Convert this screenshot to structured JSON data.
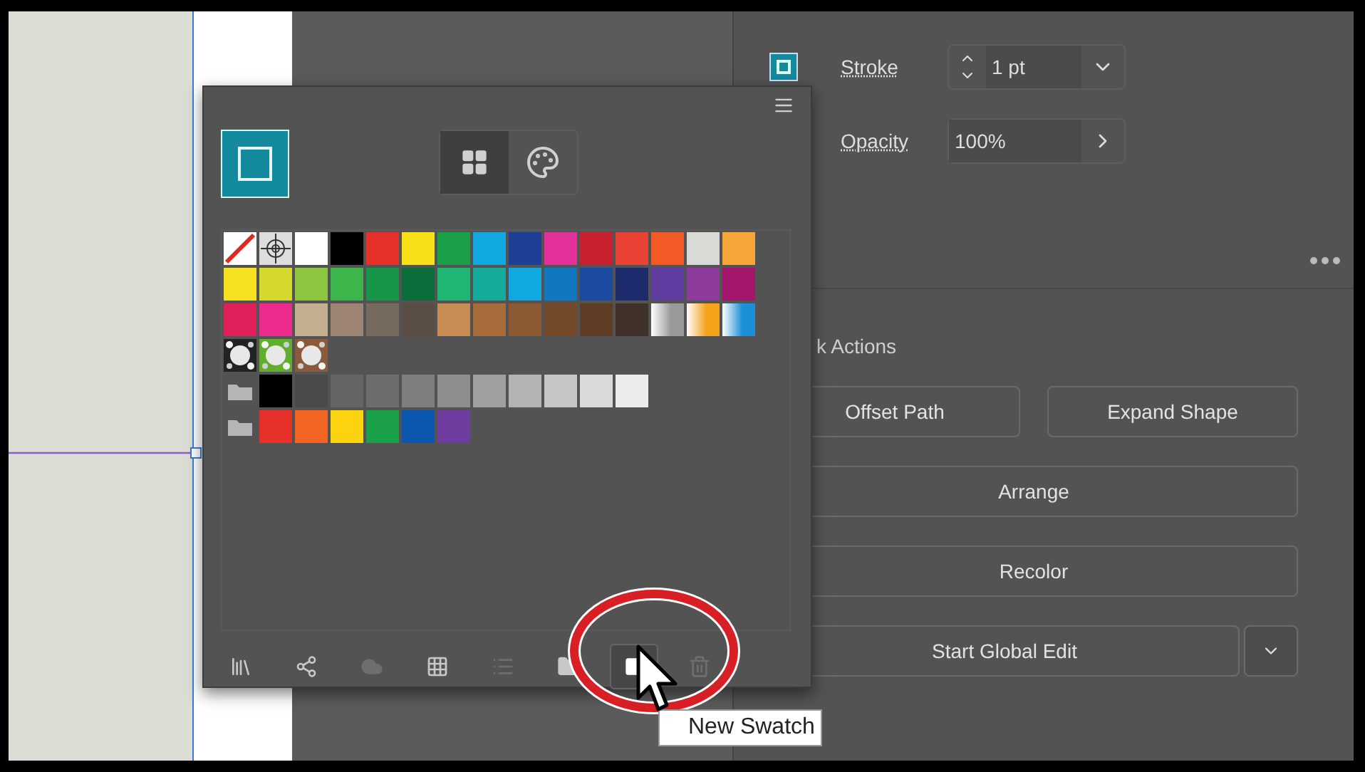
{
  "properties": {
    "stroke_label": "Stroke",
    "stroke_value": "1 pt",
    "opacity_label": "Opacity",
    "opacity_value": "100%"
  },
  "quick_actions": {
    "heading": "k Actions",
    "rows": [
      {
        "buttons": [
          "Offset Path",
          "Expand Shape"
        ],
        "has_menu": false
      },
      {
        "buttons": [
          "Arrange"
        ],
        "has_menu": false
      },
      {
        "buttons": [
          "Recolor"
        ],
        "has_menu": false
      },
      {
        "buttons": [
          "Start Global Edit"
        ],
        "has_menu": true
      }
    ]
  },
  "swatches_panel": {
    "view_tabs": [
      {
        "kind": "grid",
        "selected": true
      },
      {
        "kind": "palette",
        "selected": false
      }
    ],
    "rows": [
      {
        "folder": false,
        "swatches": [
          {
            "kind": "none",
            "color": "#ffffff"
          },
          {
            "kind": "registration",
            "color": "#dddddd"
          },
          {
            "kind": "solid",
            "color": "#ffffff"
          },
          {
            "kind": "solid",
            "color": "#000000"
          },
          {
            "kind": "solid",
            "color": "#e8302a"
          },
          {
            "kind": "solid",
            "color": "#f7e017"
          },
          {
            "kind": "solid",
            "color": "#1aa049"
          },
          {
            "kind": "solid",
            "color": "#12a9e0"
          },
          {
            "kind": "solid",
            "color": "#1d3f96"
          },
          {
            "kind": "solid",
            "color": "#e2319a"
          },
          {
            "kind": "solid",
            "color": "#c8202e"
          },
          {
            "kind": "solid",
            "color": "#ea4335"
          },
          {
            "kind": "solid",
            "color": "#f15a24"
          },
          {
            "kind": "solid",
            "color": "#d9d9d6"
          },
          {
            "kind": "solid",
            "color": "#f7a738"
          }
        ]
      },
      {
        "folder": false,
        "swatches": [
          {
            "kind": "solid",
            "color": "#f6e121"
          },
          {
            "kind": "solid",
            "color": "#d5d82c"
          },
          {
            "kind": "solid",
            "color": "#8cc63f"
          },
          {
            "kind": "solid",
            "color": "#3cb54a"
          },
          {
            "kind": "solid",
            "color": "#17964a"
          },
          {
            "kind": "solid",
            "color": "#0b6e3a"
          },
          {
            "kind": "solid",
            "color": "#1fb572"
          },
          {
            "kind": "solid",
            "color": "#14ab9a"
          },
          {
            "kind": "solid",
            "color": "#11a7e0"
          },
          {
            "kind": "solid",
            "color": "#1078c1"
          },
          {
            "kind": "solid",
            "color": "#1b4aa0"
          },
          {
            "kind": "solid",
            "color": "#1d2a6e"
          },
          {
            "kind": "solid",
            "color": "#5f3da0"
          },
          {
            "kind": "solid",
            "color": "#8e3b9e"
          },
          {
            "kind": "solid",
            "color": "#a4166b"
          }
        ]
      },
      {
        "folder": false,
        "swatches": [
          {
            "kind": "solid",
            "color": "#e11f5b"
          },
          {
            "kind": "solid",
            "color": "#ee2a8e"
          },
          {
            "kind": "solid",
            "color": "#c3b091"
          },
          {
            "kind": "solid",
            "color": "#9d8473"
          },
          {
            "kind": "solid",
            "color": "#766a5f"
          },
          {
            "kind": "solid",
            "color": "#5a4d44"
          },
          {
            "kind": "solid",
            "color": "#c68c53"
          },
          {
            "kind": "solid",
            "color": "#a66c3a"
          },
          {
            "kind": "solid",
            "color": "#8b5a32"
          },
          {
            "kind": "solid",
            "color": "#744a2a"
          },
          {
            "kind": "solid",
            "color": "#5e3d24"
          },
          {
            "kind": "solid",
            "color": "#3f302a"
          },
          {
            "kind": "gradient",
            "color": "#9a9a9a"
          },
          {
            "kind": "gradient",
            "color": "#f7a21b"
          },
          {
            "kind": "gradient",
            "color": "#1d8fd6"
          }
        ]
      },
      {
        "folder": false,
        "swatches": [
          {
            "kind": "pattern",
            "color": "#222222"
          },
          {
            "kind": "pattern",
            "color": "#5fae2e"
          },
          {
            "kind": "pattern",
            "color": "#8a5a3a"
          }
        ]
      },
      {
        "folder": true,
        "swatches": [
          {
            "kind": "solid",
            "color": "#000000"
          },
          {
            "kind": "solid",
            "color": "#4a4a4a"
          },
          {
            "kind": "solid",
            "color": "#646464"
          },
          {
            "kind": "solid",
            "color": "#6d6d6d"
          },
          {
            "kind": "solid",
            "color": "#7f7f7f"
          },
          {
            "kind": "solid",
            "color": "#8e8e8e"
          },
          {
            "kind": "solid",
            "color": "#a0a0a0"
          },
          {
            "kind": "solid",
            "color": "#b3b3b3"
          },
          {
            "kind": "solid",
            "color": "#c6c6c6"
          },
          {
            "kind": "solid",
            "color": "#dadada"
          },
          {
            "kind": "solid",
            "color": "#ececec"
          }
        ]
      },
      {
        "folder": true,
        "swatches": [
          {
            "kind": "solid",
            "color": "#e8302a"
          },
          {
            "kind": "solid",
            "color": "#f26522"
          },
          {
            "kind": "solid",
            "color": "#fdd20e"
          },
          {
            "kind": "solid",
            "color": "#1aa049"
          },
          {
            "kind": "solid",
            "color": "#0b57b0"
          },
          {
            "kind": "solid",
            "color": "#6f3ca0"
          }
        ]
      }
    ],
    "toolbar": [
      {
        "kind": "library",
        "disabled": false,
        "selected": false
      },
      {
        "kind": "connection",
        "disabled": false,
        "selected": false
      },
      {
        "kind": "cloud",
        "disabled": true,
        "selected": false
      },
      {
        "kind": "grid",
        "disabled": false,
        "selected": false
      },
      {
        "kind": "list",
        "disabled": true,
        "selected": false
      },
      {
        "kind": "folder",
        "disabled": false,
        "selected": false
      },
      {
        "kind": "new",
        "disabled": false,
        "selected": true
      },
      {
        "kind": "trash",
        "disabled": true,
        "selected": false
      }
    ]
  },
  "tooltip": "New Swatch"
}
